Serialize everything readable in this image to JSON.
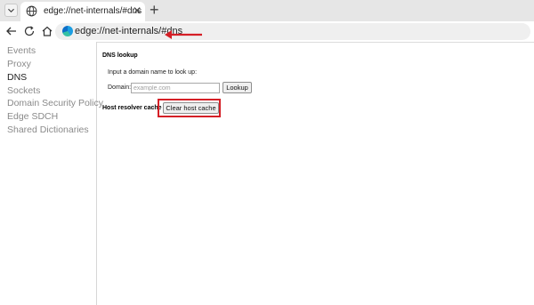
{
  "tab": {
    "title": "edge://net-internals/#dns",
    "close": "✕",
    "icon": "globe-icon"
  },
  "newtab": "+",
  "address_bar": {
    "url": "edge://net-internals/#dns"
  },
  "sidebar": {
    "items": [
      {
        "label": "Events",
        "active": false
      },
      {
        "label": "Proxy",
        "active": false
      },
      {
        "label": "DNS",
        "active": true
      },
      {
        "label": "Sockets",
        "active": false
      },
      {
        "label": "Domain Security Policy",
        "active": false
      },
      {
        "label": "Edge SDCH",
        "active": false
      },
      {
        "label": "Shared Dictionaries",
        "active": false
      }
    ]
  },
  "dns": {
    "heading": "DNS lookup",
    "instruction": "Input a domain name to look up:",
    "domain_label": "Domain:",
    "domain_placeholder": "example.com",
    "domain_value": "",
    "lookup_label": "Lookup",
    "cache_heading": "Host resolver cache",
    "clear_label": "Clear host cache"
  },
  "colors": {
    "annotation": "#d51f26",
    "edge_blue": "#1b9de2"
  }
}
